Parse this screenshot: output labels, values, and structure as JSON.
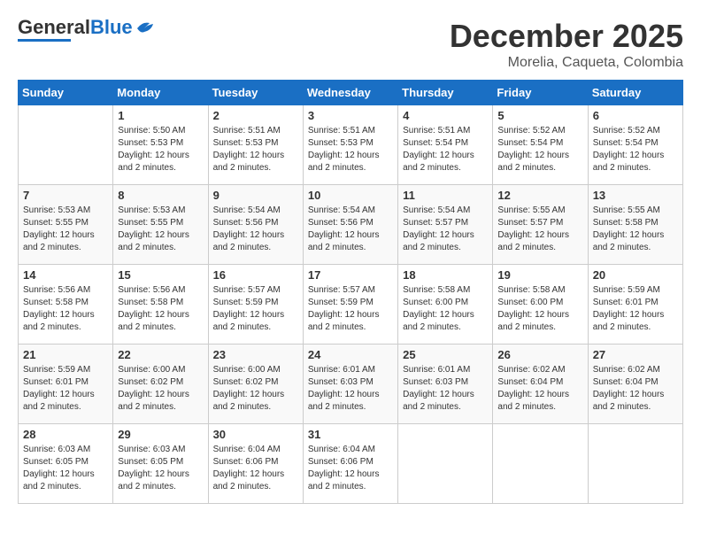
{
  "header": {
    "logo_general": "General",
    "logo_blue": "Blue",
    "month_title": "December 2025",
    "subtitle": "Morelia, Caqueta, Colombia"
  },
  "days_of_week": [
    "Sunday",
    "Monday",
    "Tuesday",
    "Wednesday",
    "Thursday",
    "Friday",
    "Saturday"
  ],
  "weeks": [
    [
      {
        "day": "",
        "info": ""
      },
      {
        "day": "1",
        "info": "Sunrise: 5:50 AM\nSunset: 5:53 PM\nDaylight: 12 hours\nand 2 minutes."
      },
      {
        "day": "2",
        "info": "Sunrise: 5:51 AM\nSunset: 5:53 PM\nDaylight: 12 hours\nand 2 minutes."
      },
      {
        "day": "3",
        "info": "Sunrise: 5:51 AM\nSunset: 5:53 PM\nDaylight: 12 hours\nand 2 minutes."
      },
      {
        "day": "4",
        "info": "Sunrise: 5:51 AM\nSunset: 5:54 PM\nDaylight: 12 hours\nand 2 minutes."
      },
      {
        "day": "5",
        "info": "Sunrise: 5:52 AM\nSunset: 5:54 PM\nDaylight: 12 hours\nand 2 minutes."
      },
      {
        "day": "6",
        "info": "Sunrise: 5:52 AM\nSunset: 5:54 PM\nDaylight: 12 hours\nand 2 minutes."
      }
    ],
    [
      {
        "day": "7",
        "info": "Sunrise: 5:53 AM\nSunset: 5:55 PM\nDaylight: 12 hours\nand 2 minutes."
      },
      {
        "day": "8",
        "info": "Sunrise: 5:53 AM\nSunset: 5:55 PM\nDaylight: 12 hours\nand 2 minutes."
      },
      {
        "day": "9",
        "info": "Sunrise: 5:54 AM\nSunset: 5:56 PM\nDaylight: 12 hours\nand 2 minutes."
      },
      {
        "day": "10",
        "info": "Sunrise: 5:54 AM\nSunset: 5:56 PM\nDaylight: 12 hours\nand 2 minutes."
      },
      {
        "day": "11",
        "info": "Sunrise: 5:54 AM\nSunset: 5:57 PM\nDaylight: 12 hours\nand 2 minutes."
      },
      {
        "day": "12",
        "info": "Sunrise: 5:55 AM\nSunset: 5:57 PM\nDaylight: 12 hours\nand 2 minutes."
      },
      {
        "day": "13",
        "info": "Sunrise: 5:55 AM\nSunset: 5:58 PM\nDaylight: 12 hours\nand 2 minutes."
      }
    ],
    [
      {
        "day": "14",
        "info": "Sunrise: 5:56 AM\nSunset: 5:58 PM\nDaylight: 12 hours\nand 2 minutes."
      },
      {
        "day": "15",
        "info": "Sunrise: 5:56 AM\nSunset: 5:58 PM\nDaylight: 12 hours\nand 2 minutes."
      },
      {
        "day": "16",
        "info": "Sunrise: 5:57 AM\nSunset: 5:59 PM\nDaylight: 12 hours\nand 2 minutes."
      },
      {
        "day": "17",
        "info": "Sunrise: 5:57 AM\nSunset: 5:59 PM\nDaylight: 12 hours\nand 2 minutes."
      },
      {
        "day": "18",
        "info": "Sunrise: 5:58 AM\nSunset: 6:00 PM\nDaylight: 12 hours\nand 2 minutes."
      },
      {
        "day": "19",
        "info": "Sunrise: 5:58 AM\nSunset: 6:00 PM\nDaylight: 12 hours\nand 2 minutes."
      },
      {
        "day": "20",
        "info": "Sunrise: 5:59 AM\nSunset: 6:01 PM\nDaylight: 12 hours\nand 2 minutes."
      }
    ],
    [
      {
        "day": "21",
        "info": "Sunrise: 5:59 AM\nSunset: 6:01 PM\nDaylight: 12 hours\nand 2 minutes."
      },
      {
        "day": "22",
        "info": "Sunrise: 6:00 AM\nSunset: 6:02 PM\nDaylight: 12 hours\nand 2 minutes."
      },
      {
        "day": "23",
        "info": "Sunrise: 6:00 AM\nSunset: 6:02 PM\nDaylight: 12 hours\nand 2 minutes."
      },
      {
        "day": "24",
        "info": "Sunrise: 6:01 AM\nSunset: 6:03 PM\nDaylight: 12 hours\nand 2 minutes."
      },
      {
        "day": "25",
        "info": "Sunrise: 6:01 AM\nSunset: 6:03 PM\nDaylight: 12 hours\nand 2 minutes."
      },
      {
        "day": "26",
        "info": "Sunrise: 6:02 AM\nSunset: 6:04 PM\nDaylight: 12 hours\nand 2 minutes."
      },
      {
        "day": "27",
        "info": "Sunrise: 6:02 AM\nSunset: 6:04 PM\nDaylight: 12 hours\nand 2 minutes."
      }
    ],
    [
      {
        "day": "28",
        "info": "Sunrise: 6:03 AM\nSunset: 6:05 PM\nDaylight: 12 hours\nand 2 minutes."
      },
      {
        "day": "29",
        "info": "Sunrise: 6:03 AM\nSunset: 6:05 PM\nDaylight: 12 hours\nand 2 minutes."
      },
      {
        "day": "30",
        "info": "Sunrise: 6:04 AM\nSunset: 6:06 PM\nDaylight: 12 hours\nand 2 minutes."
      },
      {
        "day": "31",
        "info": "Sunrise: 6:04 AM\nSunset: 6:06 PM\nDaylight: 12 hours\nand 2 minutes."
      },
      {
        "day": "",
        "info": ""
      },
      {
        "day": "",
        "info": ""
      },
      {
        "day": "",
        "info": ""
      }
    ]
  ]
}
